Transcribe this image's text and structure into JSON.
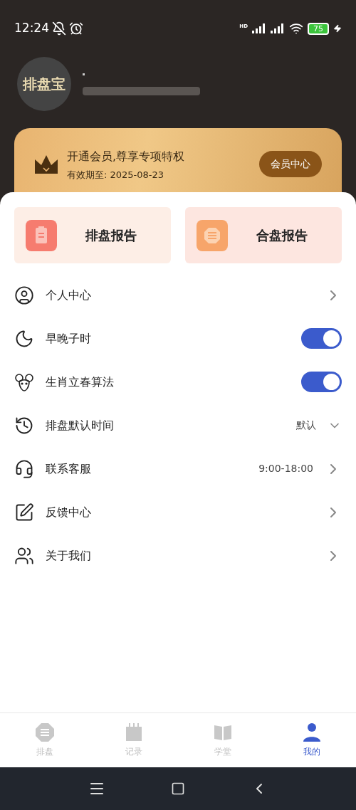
{
  "status_bar": {
    "time": "12:24",
    "network_label": "HD",
    "battery": "75"
  },
  "profile": {
    "avatar_text": "排盘宝"
  },
  "membership": {
    "title": "开通会员,尊享专项特权",
    "expiry": "有效期至: 2025-08-23",
    "button": "会员中心"
  },
  "reports": [
    {
      "label": "排盘报告",
      "kind": "chart"
    },
    {
      "label": "合盘报告",
      "kind": "match"
    }
  ],
  "menu": [
    {
      "kind": "link",
      "label": "个人中心"
    },
    {
      "kind": "toggle",
      "label": "早晚子时",
      "on": true
    },
    {
      "kind": "toggle",
      "label": "生肖立春算法",
      "on": true
    },
    {
      "kind": "select",
      "label": "排盘默认时间",
      "value": "默认"
    },
    {
      "kind": "link",
      "label": "联系客服",
      "value": "9:00-18:00"
    },
    {
      "kind": "link",
      "label": "反馈中心"
    },
    {
      "kind": "link",
      "label": "关于我们"
    }
  ],
  "tabs": [
    {
      "label": "排盘",
      "selected": false
    },
    {
      "label": "记录",
      "selected": false
    },
    {
      "label": "学堂",
      "selected": false
    },
    {
      "label": "我的",
      "selected": true
    }
  ]
}
